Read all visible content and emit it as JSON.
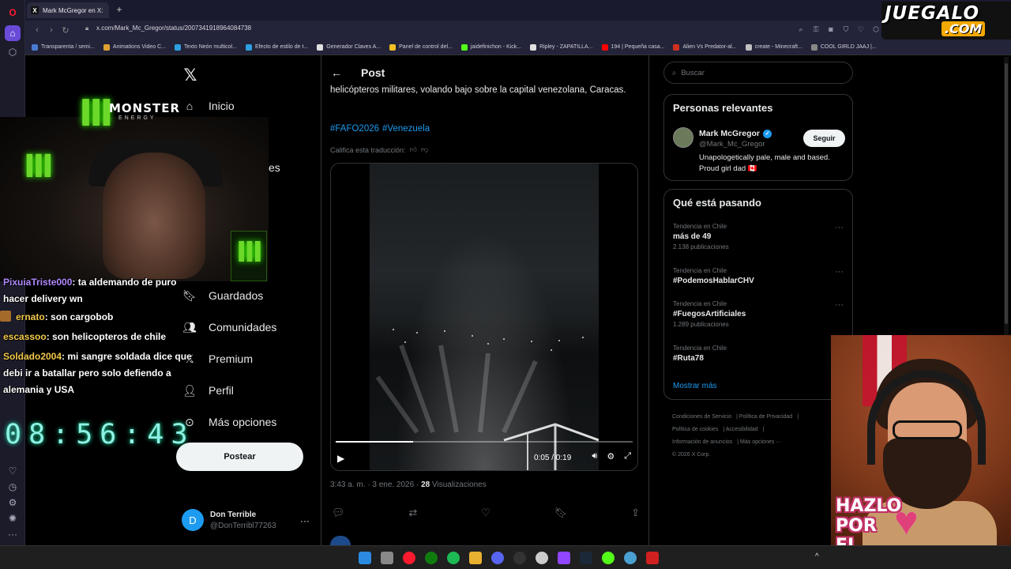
{
  "browser": {
    "tab_title": "Mark McGregor en X:",
    "url": "x.com/Mark_Mc_Gregor/status/2007341918964084738",
    "bookmarks": [
      "Transparenta / semi...",
      "Animations Video C...",
      "Texto Neón multicol...",
      "Efecto de estilo de t...",
      "Generador Claves A...",
      "Panel de control del...",
      "jaidefinichon - Kick...",
      "Ripley - ZAPATILLA...",
      "194 | Pequeña casa...",
      "Alien Vs Predator-al...",
      "create - Minecraft...",
      "COOL GIRLD JAAJ |..."
    ],
    "bookmark_colors": [
      "#4a7bd0",
      "#e0a030",
      "#2ea0e0",
      "#2ea0e0",
      "#e0e0e0",
      "#f0c020",
      "#53fc18",
      "#e0e0e0",
      "#ff0000",
      "#d03020",
      "#c0c0c0",
      "#888888"
    ]
  },
  "overlay": {
    "logo_main": "JUEGALO",
    "logo_sub": ".COM",
    "monster_text": "MONSTER",
    "monster_sub": "ENERGY",
    "clock": "08:56:43",
    "hazlo_lines": [
      "HAZLO",
      "POR",
      "EL"
    ]
  },
  "chat": [
    {
      "user": "PixuiaTriste000",
      "text": ": ta aldemando de puro hacer delivery wn"
    },
    {
      "user": "ernato",
      "text": ": son cargobob"
    },
    {
      "user": "escassoo",
      "text": ": son helicopteros de chile"
    },
    {
      "user": "Soldado2004",
      "text": ": mi sangre soldada dice que debi ir a batallar pero solo defiendo a alemania y USA"
    }
  ],
  "nav": {
    "home": "Inicio",
    "partial": "es",
    "bookmarks": "Guardados",
    "communities": "Comunidades",
    "premium": "Premium",
    "profile": "Perfil",
    "more": "Más opciones",
    "post_button": "Postear"
  },
  "account": {
    "initial": "D",
    "name": "Don Terrible",
    "handle": "@DonTerribl77263"
  },
  "post": {
    "header": "Post",
    "text": "helicópteros militares, volando bajo sobre la capital venezolana, Caracas.",
    "hashtags": [
      "#FAFO2026",
      "#Venezuela"
    ],
    "rate_translation": "Califica esta traducción:",
    "video_time": "0:05 / 0:19",
    "video_progress": 0.26,
    "timestamp": "3:43 a. m. · 3 ene. 2026 · ",
    "views_count": "28",
    "views_label": " Visualizaciones"
  },
  "sidebar": {
    "search_placeholder": "Buscar",
    "relevant_title": "Personas relevantes",
    "relevant_person": {
      "name": "Mark McGregor",
      "handle": "@Mark_Mc_Gregor",
      "bio": "Unapologetically pale, male and based. Proud girl dad 🇨🇦",
      "follow": "Seguir"
    },
    "trends_title": "Qué está pasando",
    "trends": [
      {
        "category": "Tendencia en Chile",
        "name": "más de 49",
        "count": "2.138 publicaciones"
      },
      {
        "category": "Tendencia en Chile",
        "name": "#PodemosHablarCHV",
        "count": ""
      },
      {
        "category": "Tendencia en Chile",
        "name": "#FuegosArtificiales",
        "count": "1.289 publicaciones"
      },
      {
        "category": "Tendencia en Chile",
        "name": "#Ruta78",
        "count": ""
      }
    ],
    "show_more": "Mostrar más",
    "footer": [
      "Condiciones de Servicio",
      "Política de Privacidad",
      "Política de cookies",
      "Accesibilidad",
      "Información de anuncios",
      "Más opciones ···",
      "© 2026 X Corp."
    ]
  }
}
